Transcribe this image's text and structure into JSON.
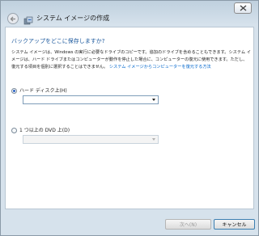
{
  "window": {
    "title": "システム イメージの作成"
  },
  "content": {
    "heading": "バックアップをどこに保存しますか?",
    "description": "システム イメージは、Windows の実行に必要なドライブのコピーです。追加のドライブを含めることもできます。システム イメージは、ハード ドライブまたはコンピューターが動作を停止した場合に、コンピューターの復元に使用できます。ただし、復元する項目を個別に選択することはできません。",
    "description_link": "システム イメージからコンピューターを復元する方法",
    "options": [
      {
        "label": "ハード ディスク上(H)",
        "checked": true,
        "value": ""
      },
      {
        "label": "1 つ以上の DVD 上(D)",
        "checked": false,
        "value": ""
      }
    ]
  },
  "buttons": {
    "next": "次へ(N)",
    "cancel": "キャンセル"
  },
  "icons": {
    "close": "close-icon",
    "back": "back-arrow-icon",
    "app": "backup-app-icon"
  }
}
